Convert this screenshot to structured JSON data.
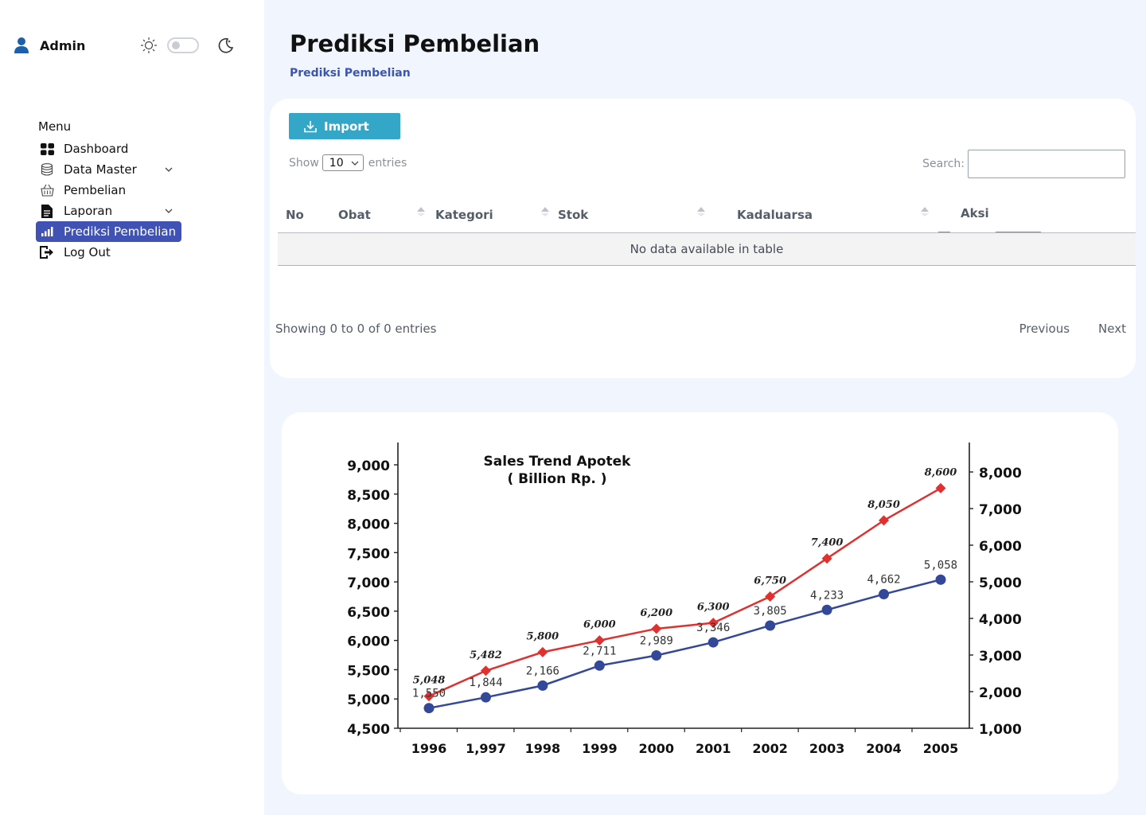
{
  "sidebar": {
    "user_name": "Admin",
    "menu_title": "Menu",
    "items": [
      {
        "label": "Dashboard",
        "icon": "dashboard-icon",
        "chevron": false,
        "active": false
      },
      {
        "label": "Data Master",
        "icon": "database-icon",
        "chevron": true,
        "active": false
      },
      {
        "label": "Pembelian",
        "icon": "basket-icon",
        "chevron": false,
        "active": false
      },
      {
        "label": "Laporan",
        "icon": "document-icon",
        "chevron": true,
        "active": false
      },
      {
        "label": "Prediksi Pembelian",
        "icon": "bar-chart-icon",
        "chevron": false,
        "active": true
      },
      {
        "label": "Log Out",
        "icon": "logout-icon",
        "chevron": false,
        "active": false
      }
    ]
  },
  "header": {
    "title": "Prediksi Pembelian",
    "breadcrumb": "Prediksi Pembelian"
  },
  "table_card": {
    "import_label": "Import",
    "show_label": "Show",
    "entries_value": "10",
    "entries_label": "entries",
    "search_label": "Search:",
    "search_value": "",
    "columns": [
      "No",
      "Obat",
      "Kategori",
      "Stok",
      "Kadaluarsa",
      "Aksi"
    ],
    "empty_message": "No data available in table",
    "info": "Showing 0 to 0 of 0 entries",
    "prev_label": "Previous",
    "next_label": "Next"
  },
  "colors": {
    "accent": "#4053b5",
    "import_button": "#34a6c8",
    "series_red": "#e03131",
    "series_blue": "#34489a"
  },
  "chart_data": {
    "type": "line",
    "title": "Sales Trend  Apotek",
    "subtitle": "( Billion  Rp. )",
    "categories": [
      "1996",
      "1,997",
      "1998",
      "1999",
      "2000",
      "2001",
      "2002",
      "2003",
      "2004",
      "2005"
    ],
    "left_axis": {
      "min": 4500,
      "max": 9000,
      "ticks": [
        "4,500",
        "5,000",
        "5,500",
        "6,000",
        "6,500",
        "7,000",
        "7,500",
        "8,000",
        "8,500",
        "9,000"
      ]
    },
    "right_axis": {
      "min": 1000,
      "max": 8000,
      "ticks": [
        "1,000",
        "2,000",
        "3,000",
        "4,000",
        "5,000",
        "6,000",
        "7,000",
        "8,000"
      ]
    },
    "series": [
      {
        "values": [
          5048,
          5482,
          5800,
          6000,
          6200,
          6300,
          6750,
          7400,
          8050,
          8600
        ],
        "labels": [
          "5,048",
          "5,482",
          "5,800",
          "6,000",
          "6,200",
          "6,300",
          "6,750",
          "7,400",
          "8,050",
          "8,600"
        ],
        "axis": "left",
        "marker": "diamond",
        "color": "#e03131"
      },
      {
        "values": [
          1550,
          1844,
          2166,
          2711,
          2989,
          3346,
          3805,
          4233,
          4662,
          5058
        ],
        "labels": [
          "1,550",
          "1,844",
          "2,166",
          "2,711",
          "2,989",
          "3,346",
          "3,805",
          "4,233",
          "4,662",
          "5,058"
        ],
        "axis": "right",
        "marker": "circle",
        "color": "#34489a"
      }
    ],
    "grid": false
  }
}
